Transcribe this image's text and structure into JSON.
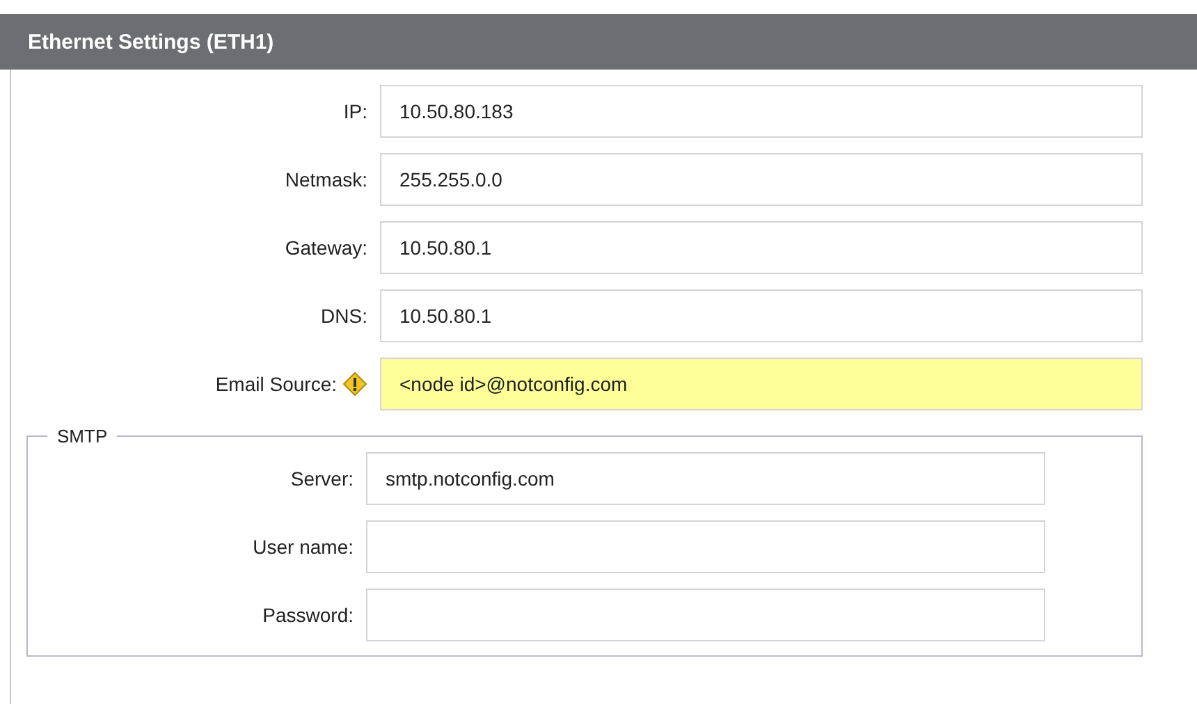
{
  "panel": {
    "title": "Ethernet Settings (ETH1)"
  },
  "fields": [
    {
      "label": "IP:",
      "value": "10.50.80.183",
      "warning": false
    },
    {
      "label": "Netmask:",
      "value": "255.255.0.0",
      "warning": false
    },
    {
      "label": "Gateway:",
      "value": "10.50.80.1",
      "warning": false
    },
    {
      "label": "DNS:",
      "value": "10.50.80.1",
      "warning": false
    },
    {
      "label": "Email Source:",
      "value": "<node id>@notconfig.com",
      "warning": true
    }
  ],
  "smtp": {
    "legend": "SMTP",
    "fields": [
      {
        "label": "Server:",
        "value": "smtp.notconfig.com"
      },
      {
        "label": "User name:"
      },
      {
        "label": "Password:"
      }
    ]
  }
}
